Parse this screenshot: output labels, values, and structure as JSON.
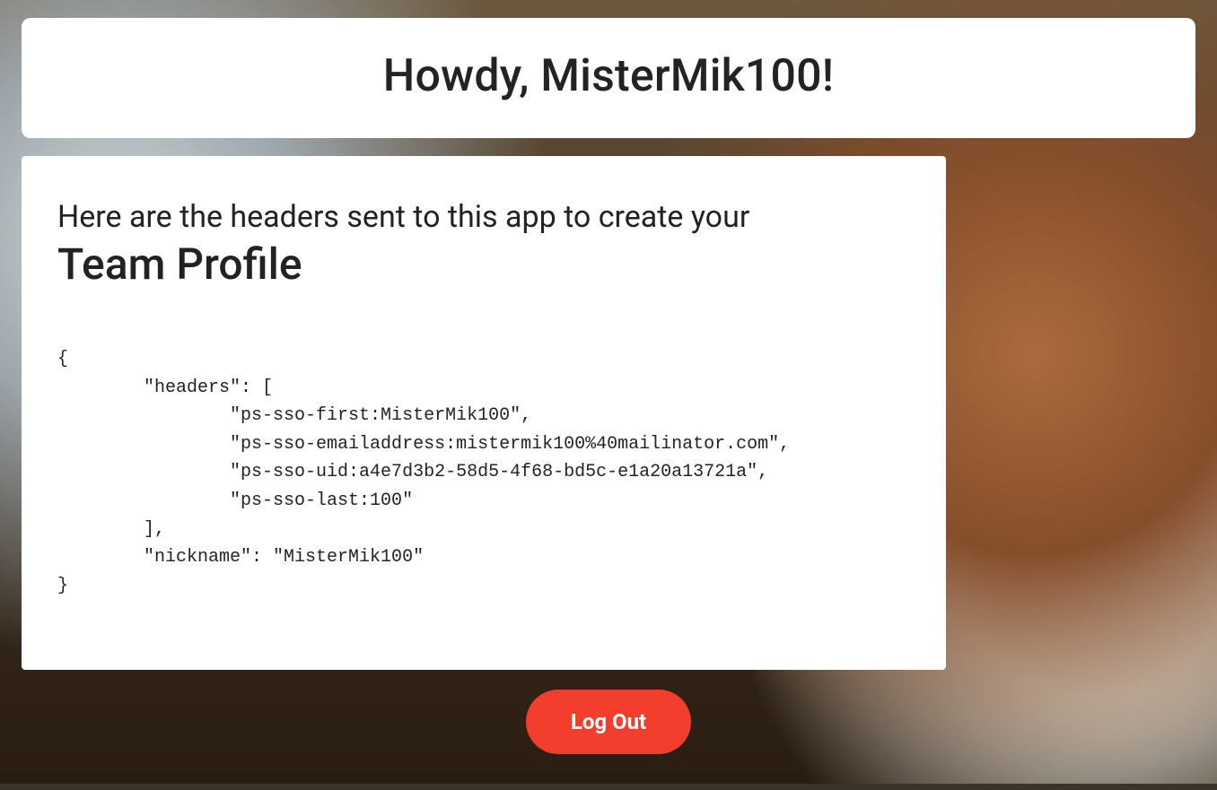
{
  "greeting": {
    "title": "Howdy, MisterMik100!"
  },
  "info": {
    "lead_line": "Here are the headers sent to this app to create your",
    "subtitle": "Team Profile",
    "code": "{\n        \"headers\": [\n                \"ps-sso-first:MisterMik100\",\n                \"ps-sso-emailaddress:mistermik100%40mailinator.com\",\n                \"ps-sso-uid:a4e7d3b2-58d5-4f68-bd5c-e1a20a13721a\",\n                \"ps-sso-last:100\"\n        ],\n        \"nickname\": \"MisterMik100\"\n}"
  },
  "actions": {
    "logout_label": "Log Out"
  }
}
